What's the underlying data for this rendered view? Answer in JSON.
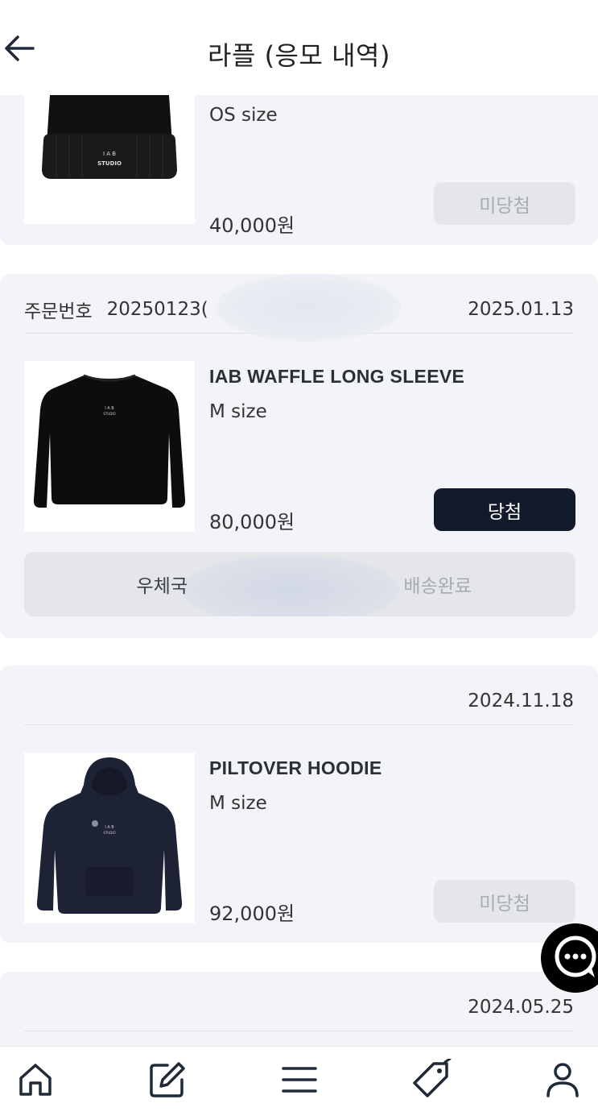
{
  "header": {
    "title": "라플 (응모 내역)",
    "back_icon": "arrow-left-icon"
  },
  "raffles": [
    {
      "size": "OS size",
      "price": "40,000원",
      "status": "미당첨",
      "image": "black-beanie-iab-studio"
    },
    {
      "order_label": "주문번호",
      "order_number": "20250123(",
      "date": "2025.01.13",
      "name": "IAB WAFFLE LONG SLEEVE",
      "size": "M size",
      "price": "80,000원",
      "status": "당첨",
      "image": "black-waffle-long-sleeve",
      "shipping": {
        "carrier": "우체국",
        "status": "배송완료"
      }
    },
    {
      "date": "2024.11.18",
      "name": "PILTOVER HOODIE",
      "size": "M size",
      "price": "92,000원",
      "status": "미당첨",
      "image": "navy-hoodie"
    },
    {
      "date": "2024.05.25"
    }
  ],
  "chat_icon": "chat-bubble-icon",
  "bottom_nav": [
    {
      "name": "home",
      "icon": "home-icon"
    },
    {
      "name": "write",
      "icon": "edit-icon"
    },
    {
      "name": "menu",
      "icon": "menu-icon"
    },
    {
      "name": "tag",
      "icon": "tag-icon"
    },
    {
      "name": "profile",
      "icon": "user-icon"
    }
  ],
  "colors": {
    "win": "#121a2c",
    "lose_bg": "#e4e6ea",
    "lose_text": "#a7acb4",
    "card_bg": "#f3f4f7"
  }
}
